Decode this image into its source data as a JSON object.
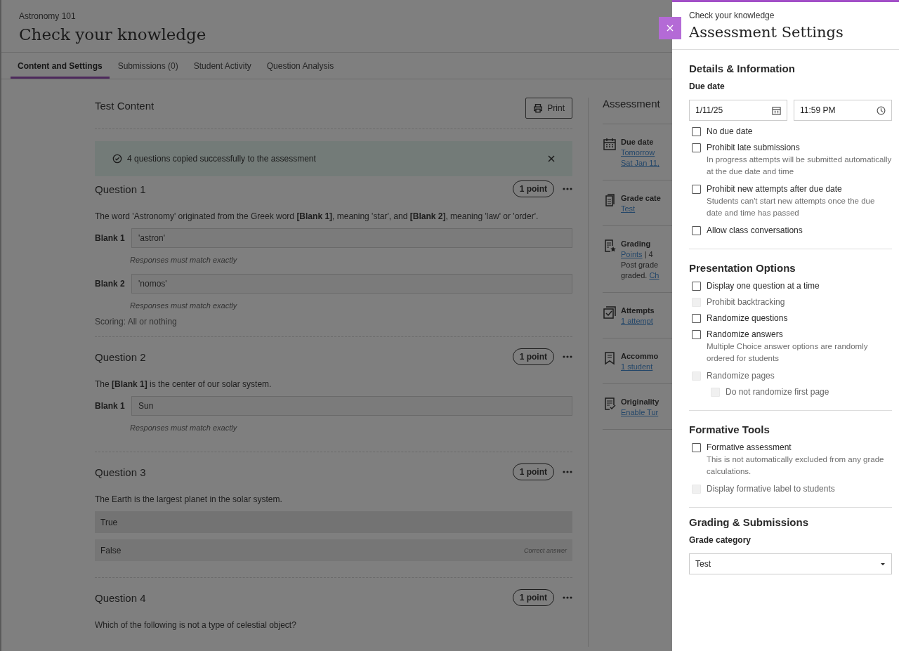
{
  "course": "Astronomy 101",
  "title": "Check your knowledge",
  "tabs": [
    {
      "label": "Content and Settings",
      "selected": true
    },
    {
      "label": "Submissions (0)",
      "selected": false
    },
    {
      "label": "Student Activity",
      "selected": false
    },
    {
      "label": "Question Analysis",
      "selected": false
    }
  ],
  "test_content": {
    "heading": "Test Content",
    "print_button": "Print",
    "banner": {
      "text": "4 questions copied successfully to the assessment"
    },
    "questions": [
      {
        "kind": "fill_blank",
        "title": "Question 1",
        "points": "1 point",
        "text": "The word 'Astronomy' originated from the Greek word **[Blank 1]**, meaning 'star', and **[Blank 2]**, meaning 'law' or 'order'.",
        "blanks": [
          {
            "label": "Blank 1",
            "value": "'astron'",
            "note": "Responses must match exactly"
          },
          {
            "label": "Blank 2",
            "value": "'nomos'",
            "note": "Responses must match exactly"
          }
        ],
        "scoring": "Scoring: All or nothing"
      },
      {
        "kind": "fill_blank",
        "title": "Question 2",
        "points": "1 point",
        "text": "The **[Blank 1]** is the center of our solar system.",
        "blanks": [
          {
            "label": "Blank 1",
            "value": "Sun",
            "note": "Responses must match exactly"
          }
        ]
      },
      {
        "kind": "true_false",
        "title": "Question 3",
        "points": "1 point",
        "text": "The Earth is the largest planet in the solar system.",
        "correct_note": "Correct answer",
        "answers": [
          {
            "label": "True",
            "correct": false
          },
          {
            "label": "False",
            "correct": true
          }
        ]
      },
      {
        "kind": "multiple_choice",
        "title": "Question 4",
        "points": "1 point",
        "text": "Which of the following is not a type of celestial object?"
      }
    ]
  },
  "summary": {
    "heading": "Assessment",
    "items": [
      {
        "kind": "calendar",
        "title": "Due date",
        "lines": [
          [
            {
              "text": "Tomorrow",
              "link": true
            }
          ],
          [
            {
              "text": "Sat Jan 11,",
              "link": true
            }
          ]
        ]
      },
      {
        "kind": "document",
        "title": "Grade cate",
        "lines": [
          [
            {
              "text": "Test",
              "link": true
            }
          ]
        ]
      },
      {
        "kind": "grading",
        "title": "Grading",
        "lines": [
          [
            {
              "text": "Points",
              "link": true
            },
            {
              "text": " | 4",
              "link": false
            }
          ],
          [
            {
              "text": "Post grade",
              "link": false
            }
          ],
          [
            {
              "text": "graded. ",
              "link": false
            },
            {
              "text": "Ch",
              "link": true
            }
          ]
        ]
      },
      {
        "kind": "attempts",
        "title": "Attempts",
        "lines": [
          [
            {
              "text": "1 attempt",
              "link": true
            }
          ]
        ]
      },
      {
        "kind": "bookmark",
        "title": "Accommo",
        "lines": [
          [
            {
              "text": "1 student",
              "link": true
            }
          ]
        ]
      },
      {
        "kind": "originality",
        "title": "Originality",
        "lines": [
          [
            {
              "text": "Enable Tur",
              "link": true
            }
          ]
        ]
      }
    ]
  },
  "panel": {
    "breadcrumb": "Check your knowledge",
    "title": "Assessment Settings",
    "sections": [
      {
        "heading": "Details & Information",
        "fields": [
          {
            "kind": "label",
            "text": "Due date"
          },
          {
            "kind": "date_time",
            "date": "1/11/25",
            "time": "11:59 PM"
          },
          {
            "kind": "checkbox",
            "label": "No due date",
            "checked": false,
            "disabled": false
          },
          {
            "kind": "checkbox",
            "label": "Prohibit late submissions",
            "checked": false,
            "disabled": false,
            "help": "In progress attempts will be submitted automatically at the due date and time"
          },
          {
            "kind": "checkbox",
            "label": "Prohibit new attempts after due date",
            "checked": false,
            "disabled": false,
            "help": "Students can't start new attempts once the due date and time has passed"
          },
          {
            "kind": "checkbox",
            "label": "Allow class conversations",
            "checked": false,
            "disabled": false
          }
        ]
      },
      {
        "heading": "Presentation Options",
        "fields": [
          {
            "kind": "checkbox",
            "label": "Display one question at a time",
            "checked": false,
            "disabled": false
          },
          {
            "kind": "checkbox",
            "label": "Prohibit backtracking",
            "checked": false,
            "disabled": true
          },
          {
            "kind": "checkbox",
            "label": "Randomize questions",
            "checked": false,
            "disabled": false
          },
          {
            "kind": "checkbox",
            "label": "Randomize answers",
            "checked": false,
            "disabled": false,
            "help": "Multiple Choice answer options are randomly ordered for students"
          },
          {
            "kind": "checkbox",
            "label": "Randomize pages",
            "checked": false,
            "disabled": true,
            "children": [
              {
                "label": "Do not randomize first page",
                "checked": false,
                "disabled": true
              }
            ]
          }
        ]
      },
      {
        "heading": "Formative Tools",
        "fields": [
          {
            "kind": "checkbox",
            "label": "Formative assessment",
            "checked": false,
            "disabled": false,
            "help": "This is not automatically excluded from any grade calculations."
          },
          {
            "kind": "checkbox",
            "label": "Display formative label to students",
            "checked": false,
            "disabled": true
          }
        ]
      },
      {
        "heading": "Grading & Submissions",
        "fields": [
          {
            "kind": "label",
            "text": "Grade category"
          },
          {
            "kind": "select",
            "value": "Test"
          }
        ]
      }
    ]
  }
}
